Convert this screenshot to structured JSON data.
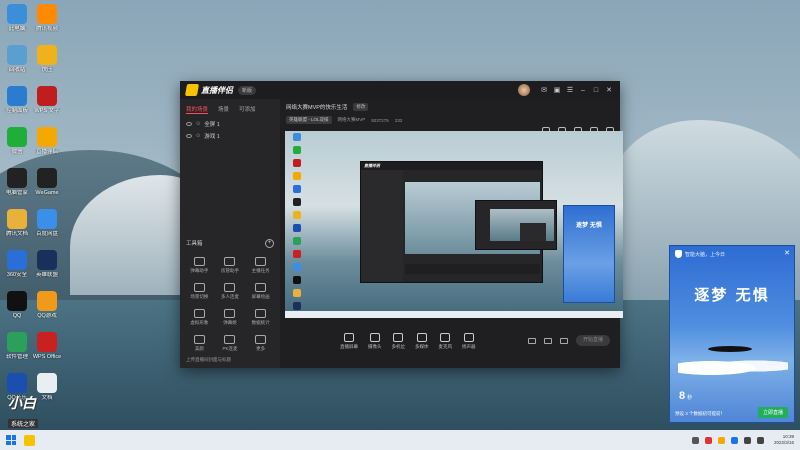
{
  "desktop": {
    "icons": [
      {
        "label": "此电脑",
        "color": "#3a8fd8"
      },
      {
        "label": "腾讯视频",
        "color": "#ff8a00"
      },
      {
        "label": "回收站",
        "color": "#5a9fd0"
      },
      {
        "label": "快压",
        "color": "#f0b21a"
      },
      {
        "label": "控制面板",
        "color": "#2b7bd0"
      },
      {
        "label": "WPS 文字",
        "color": "#c01e1e"
      },
      {
        "label": "微信",
        "color": "#1fae3a"
      },
      {
        "label": "直播伴侣",
        "color": "#f5a800"
      },
      {
        "label": "电脑管家",
        "color": "#222"
      },
      {
        "label": "WeGame",
        "color": "#222"
      },
      {
        "label": "腾讯文档",
        "color": "#e8b23a"
      },
      {
        "label": "百度网盘",
        "color": "#3a8fe8"
      },
      {
        "label": "360安全",
        "color": "#2a6ed8"
      },
      {
        "label": "英雄联盟",
        "color": "#1a2f5a"
      },
      {
        "label": "QQ",
        "color": "#111"
      },
      {
        "label": "QQ游戏",
        "color": "#f09a1a"
      },
      {
        "label": "软件管理",
        "color": "#2aa05a"
      },
      {
        "label": "WPS Office",
        "color": "#c92020"
      },
      {
        "label": "QQ音乐",
        "color": "#1a4fb0"
      },
      {
        "label": "文档",
        "color": "#e8eef2"
      }
    ]
  },
  "app": {
    "name": "直播伴侣",
    "version_badge": "新版",
    "sidebar": {
      "tabs": [
        "我的场景",
        "场景",
        "可添加"
      ],
      "scenes": [
        "全屏 1",
        "游戏 1"
      ],
      "tools_title": "工具箱",
      "tools": [
        "弹幕助手",
        "房管助手",
        "主播任务",
        "场景切换",
        "多人连麦",
        "屏幕绘画",
        "虚拟形象",
        "弹幕姬",
        "数据统计",
        "美颜",
        "PK连麦",
        "更多"
      ],
      "footer": "上传直播间封面与标题"
    },
    "room": {
      "title": "网络大赛MVP的快乐生活",
      "edit_label": "修改",
      "category": "英雄联盟 - LOL双排",
      "sub1": "网络大赛MVP",
      "sub2": "9237275",
      "sub3": "232"
    },
    "nested_title": "直播伴侣",
    "mini_ad_text": "逐梦 无惧",
    "controls": [
      "直播屏幕",
      "摄像头",
      "多机位",
      "多媒体",
      "麦克风",
      "扬声器"
    ],
    "live_button": "开始直播"
  },
  "ad": {
    "header": "智能大脑，上今日",
    "title": "逐梦 无惧",
    "countdown": "8",
    "countdown_unit": "秒",
    "footer": "预设 3 个数据初可提前！",
    "button": "立即直播"
  },
  "watermark": {
    "main": "小白",
    "sub": "系统之家"
  },
  "taskbar": {
    "time": "10:39",
    "date": "2022/3/16"
  }
}
